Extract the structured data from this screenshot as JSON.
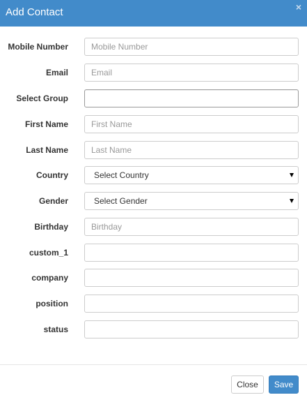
{
  "header": {
    "title": "Add Contact",
    "close_glyph": "×"
  },
  "form": {
    "mobile": {
      "label": "Mobile Number",
      "placeholder": "Mobile Number",
      "value": ""
    },
    "email": {
      "label": "Email",
      "placeholder": "Email",
      "value": ""
    },
    "group": {
      "label": "Select Group",
      "placeholder": "",
      "value": ""
    },
    "first": {
      "label": "First Name",
      "placeholder": "First Name",
      "value": ""
    },
    "last": {
      "label": "Last Name",
      "placeholder": "Last Name",
      "value": ""
    },
    "country": {
      "label": "Country",
      "selected": "Select Country"
    },
    "gender": {
      "label": "Gender",
      "selected": "Select Gender"
    },
    "birthday": {
      "label": "Birthday",
      "placeholder": "Birthday",
      "value": ""
    },
    "custom_1": {
      "label": "custom_1",
      "value": ""
    },
    "company": {
      "label": "company",
      "value": ""
    },
    "position": {
      "label": "position",
      "value": ""
    },
    "status": {
      "label": "status",
      "value": ""
    }
  },
  "footer": {
    "close_label": "Close",
    "save_label": "Save"
  },
  "colors": {
    "header_bg": "#428bca",
    "primary_button": "#428bca"
  },
  "icons": {
    "close": "close-icon",
    "dropdown": "caret-down-icon"
  }
}
